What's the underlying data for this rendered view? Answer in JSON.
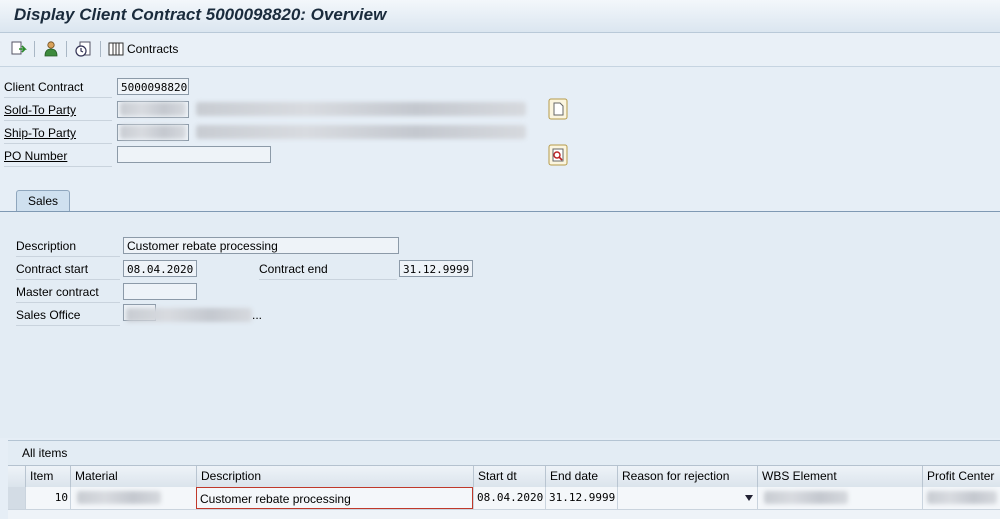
{
  "window": {
    "title": "Display Client Contract 5000098820: Overview"
  },
  "toolbar": {
    "contracts_label": "Contracts"
  },
  "header": {
    "client_contract_label": "Client Contract",
    "client_contract_value": "5000098820",
    "sold_to_label": "Sold-To Party",
    "ship_to_label": "Ship-To Party",
    "po_number_label": "PO Number"
  },
  "tabs": [
    {
      "label": "Sales"
    }
  ],
  "sales": {
    "description_label": "Description",
    "description_value": "Customer rebate processing",
    "contract_start_label": "Contract start",
    "contract_start_value": "08.04.2020",
    "contract_end_label": "Contract end",
    "contract_end_value": "31.12.9999",
    "master_contract_label": "Master contract",
    "sales_office_label": "Sales Office",
    "sales_office_suffix": "..."
  },
  "items": {
    "title": "All items",
    "columns": [
      "Item",
      "Material",
      "Description",
      "Start dt",
      "End date",
      "Reason for rejection",
      "WBS Element",
      "Profit Center"
    ],
    "rows": [
      {
        "item": "10",
        "description": "Customer rebate processing",
        "start": "08.04.2020",
        "end": "31.12.9999"
      }
    ]
  },
  "colors": {
    "accent": "#7f99b3",
    "background": "#e6eef6"
  }
}
